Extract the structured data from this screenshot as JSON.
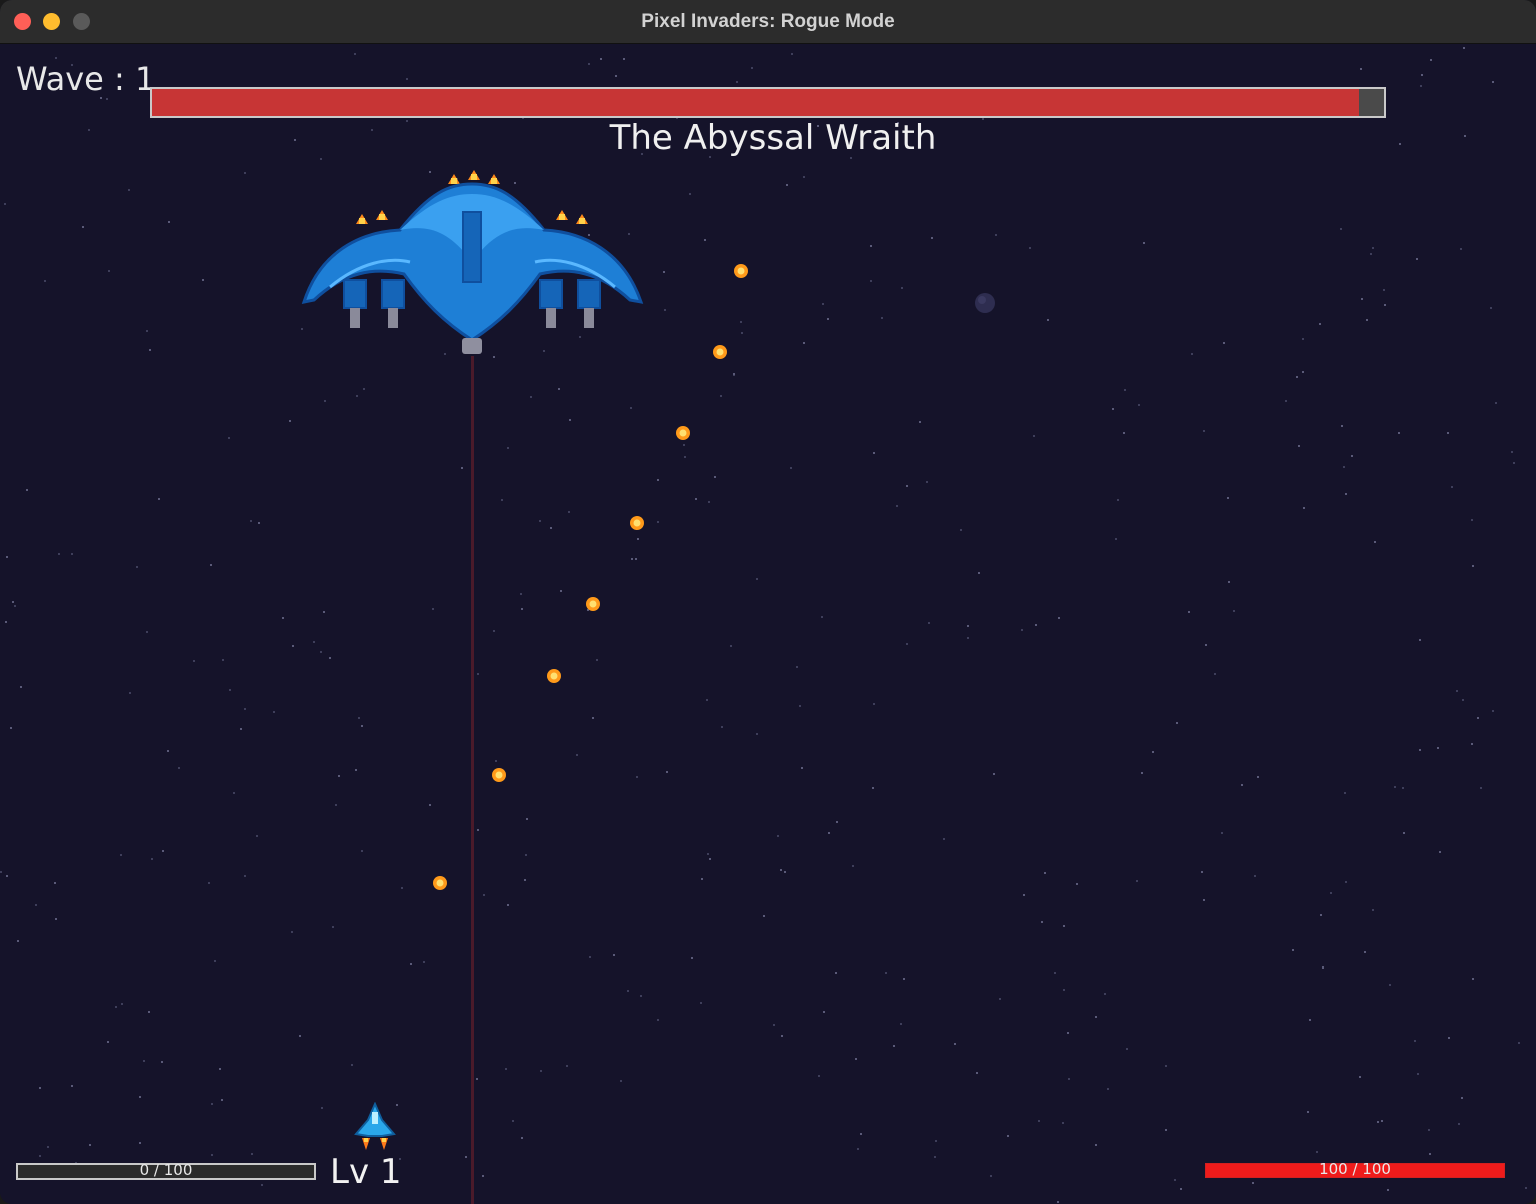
{
  "window": {
    "title": "Pixel Invaders: Rogue Mode"
  },
  "hud": {
    "wave_text": "Wave : 1",
    "boss_name": "The Abyssal Wraith",
    "boss_health_fraction": 0.98,
    "xp_text": "0 / 100",
    "xp_fraction": 0,
    "level_text": "Lv 1",
    "hp_text": "100 / 100",
    "hp_fraction": 1.0
  },
  "colors": {
    "background": "#15132a",
    "boss_bar": "#c73535",
    "hp_bar": "#ef1b1b",
    "projectile": "#ff9a1a",
    "boss_ship": "#1e7fd6"
  },
  "icons": [
    "boss-ship-icon",
    "player-ship-icon",
    "fireball-icon",
    "planet-icon"
  ]
}
